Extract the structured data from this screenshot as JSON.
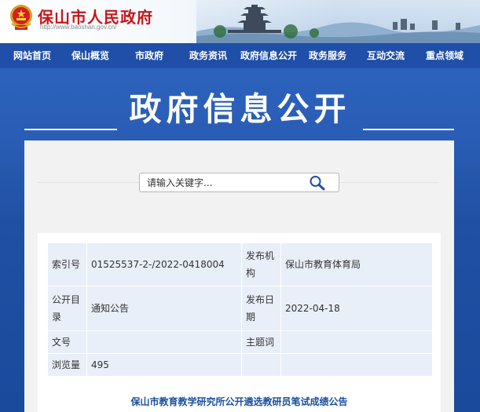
{
  "header": {
    "site_title": "保山市人民政府",
    "site_url": "http://www.baoshan.gov.cn/"
  },
  "nav": {
    "items": [
      "网站首页",
      "保山概览",
      "市政府",
      "政务资讯",
      "政府信息公开",
      "政务服务",
      "互动交流",
      "重点领域"
    ]
  },
  "banner": {
    "title": "政府信息公开"
  },
  "search": {
    "placeholder": "请输入关键字..."
  },
  "info": {
    "rows": [
      {
        "label1": "索引号",
        "value1": "01525537-2-/2022-0418004",
        "label2": "发布机构",
        "value2": "保山市教育体育局"
      },
      {
        "label1": "公开目录",
        "value1": "通知公告",
        "label2": "发布日期",
        "value2": "2022-04-18"
      },
      {
        "label1": "文号",
        "value1": "",
        "label2": "主题词",
        "value2": ""
      },
      {
        "label1": "浏览量",
        "value1": "495",
        "label2": "",
        "value2": ""
      }
    ]
  },
  "article": {
    "title": "保山市教育教学研究所公开遴选教研员笔试成绩公告"
  },
  "colors": {
    "nav_bg": "#1f4fa8",
    "title_red": "#c8161d",
    "link_blue": "#1a4f9c",
    "table_cell": "#e8eff8"
  }
}
